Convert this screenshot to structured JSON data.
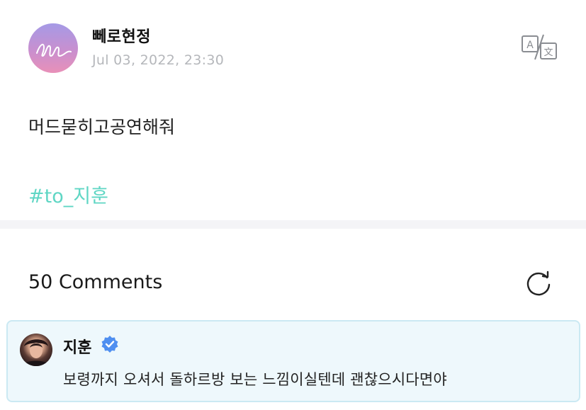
{
  "post": {
    "author": "뻬로현정",
    "date": "Jul 03, 2022, 23:30",
    "body": "머드묻히고공연해줘",
    "hashtag": "#to_지훈"
  },
  "icons": {
    "translate": "translate-icon",
    "refresh": "refresh-icon",
    "verified": "verified-badge-icon"
  },
  "comments": {
    "count_label": "50 Comments",
    "items": [
      {
        "author": "지훈",
        "verified": true,
        "text": "보령까지 오셔서 돌하르방 보는 느낌이실텐데 괜찮으시다면야"
      }
    ]
  },
  "colors": {
    "hashtag": "#5fd6c4",
    "comment_bg": "#eef8fc",
    "comment_border": "#cbe9f3",
    "verified": "#4f8ff0",
    "divider": "#f4f4f7",
    "date": "#b5b7bb"
  }
}
